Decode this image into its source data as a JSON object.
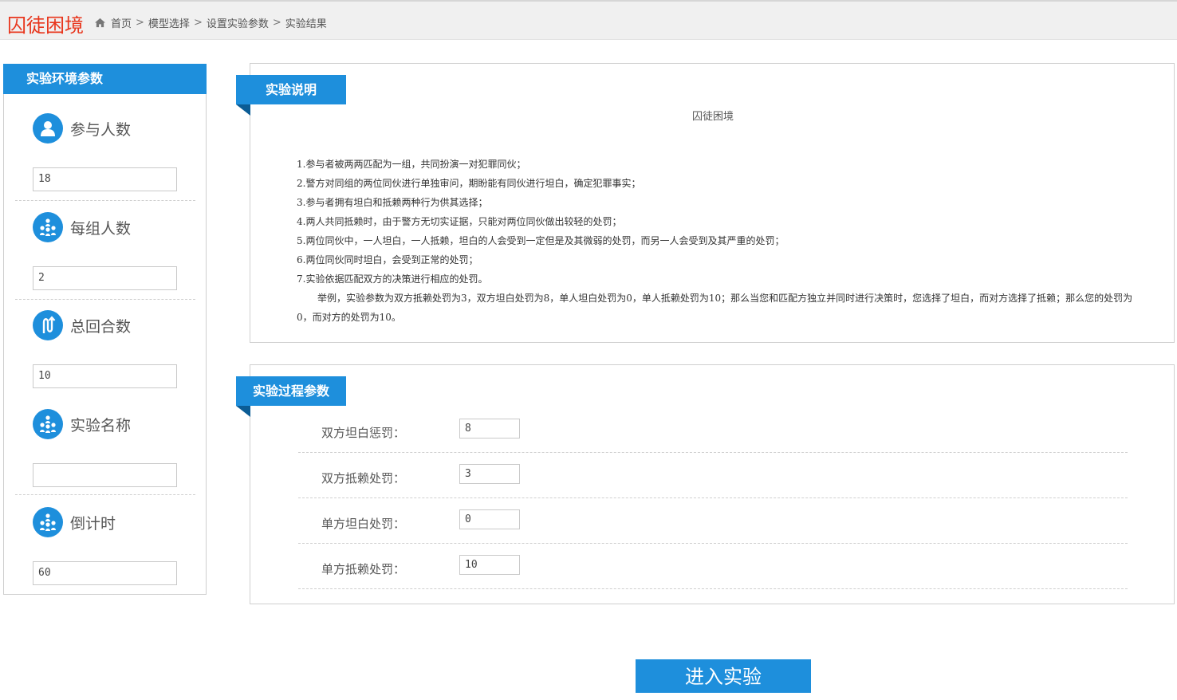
{
  "header": {
    "app_title": "囚徒困境",
    "breadcrumb": [
      "首页",
      "模型选择",
      "设置实验参数",
      "实验结果"
    ],
    "separator": ">"
  },
  "env_params": {
    "title": "实验环境参数",
    "items": [
      {
        "label": "参与人数",
        "icon": "user-icon",
        "value": "18"
      },
      {
        "label": "每组人数",
        "icon": "group-icon",
        "value": "2"
      },
      {
        "label": "总回合数",
        "icon": "loop-icon",
        "value": "10"
      },
      {
        "label": "实验名称",
        "icon": "group-icon",
        "value": ""
      },
      {
        "label": "倒计时",
        "icon": "group-icon",
        "value": "60"
      }
    ]
  },
  "description": {
    "ribbon": "实验说明",
    "title": "囚徒困境",
    "lines": [
      "1.参与者被两两匹配为一组，共同扮演一对犯罪同伙；",
      "2.警方对同组的两位同伙进行单独审问，期盼能有同伙进行坦白，确定犯罪事实；",
      "3.参与者拥有坦白和抵赖两种行为供其选择；",
      "4.两人共同抵赖时，由于警方无切实证据，只能对两位同伙做出较轻的处罚；",
      "5.两位同伙中，一人坦白，一人抵赖，坦白的人会受到一定但是及其微弱的处罚，而另一人会受到及其严重的处罚；",
      "6.两位同伙同时坦白，会受到正常的处罚；",
      "7.实验依据匹配双方的决策进行相应的处罚。"
    ],
    "example": "举例，实验参数为双方抵赖处罚为3，双方坦白处罚为8，单人坦白处罚为0，单人抵赖处罚为10；那么当您和匹配方独立并同时进行决策时，您选择了坦白，而对方选择了抵赖；那么您的处罚为0，而对方的处罚为10。"
  },
  "process_params": {
    "ribbon": "实验过程参数",
    "items": [
      {
        "label": "双方坦白惩罚：",
        "value": "8"
      },
      {
        "label": "双方抵赖处罚：",
        "value": "3"
      },
      {
        "label": "单方坦白处罚：",
        "value": "0"
      },
      {
        "label": "单方抵赖处罚：",
        "value": "10"
      }
    ]
  },
  "actions": {
    "enter": "进入实验"
  },
  "colors": {
    "accent": "#1e8fdc",
    "title_red": "#e8361d",
    "ribbon_fold": "#0b5c95"
  }
}
